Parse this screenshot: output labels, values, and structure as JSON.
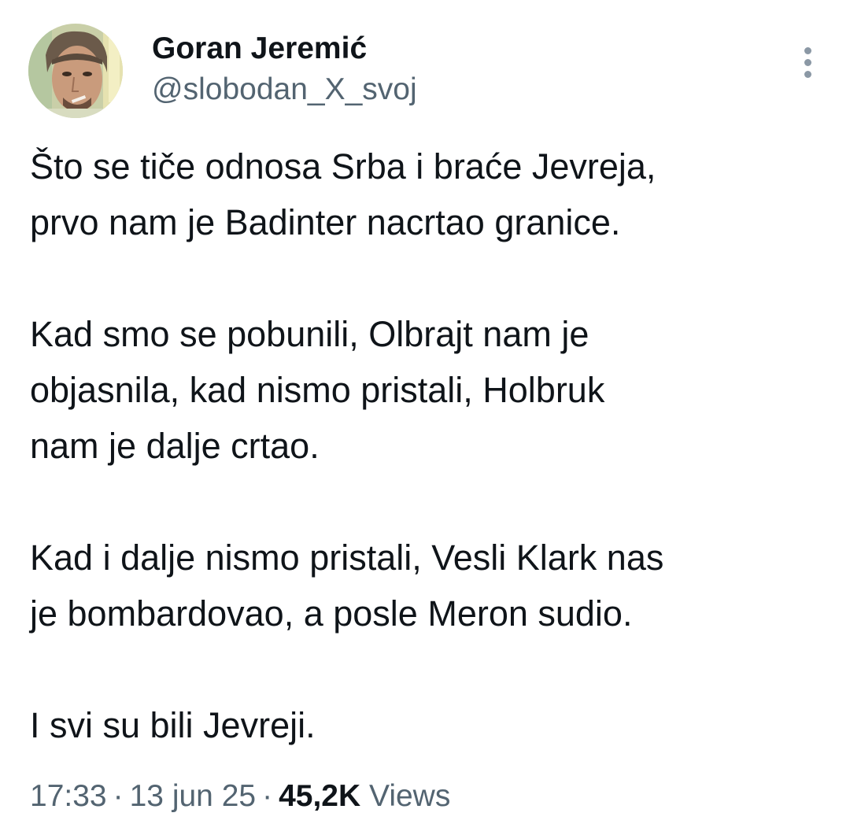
{
  "author": {
    "display_name": "Goran Jeremić",
    "handle": "@slobodan_X_svoj",
    "avatar_icon": "profile-photo"
  },
  "more_icon": "more-vertical-icon",
  "tweet": {
    "paragraphs": [
      "Što se tiče odnosa Srba i braće Jevreja,\nprvo nam je Badinter nacrtao granice.",
      "Kad smo se pobunili, Olbrajt nam je\nobjasnila, kad nismo pristali, Holbruk\nnam je dalje crtao.",
      "Kad i dalje nismo pristali, Vesli Klark nas\nje bombardovao, a posle Meron sudio.",
      "I svi su bili Jevreji."
    ]
  },
  "meta": {
    "time": "17:33",
    "separator": "·",
    "date": "13 jun 25",
    "views_count": "45,2K",
    "views_label": "Views"
  },
  "colors": {
    "text_primary": "#0f1419",
    "text_secondary": "#536471",
    "background": "#ffffff"
  }
}
